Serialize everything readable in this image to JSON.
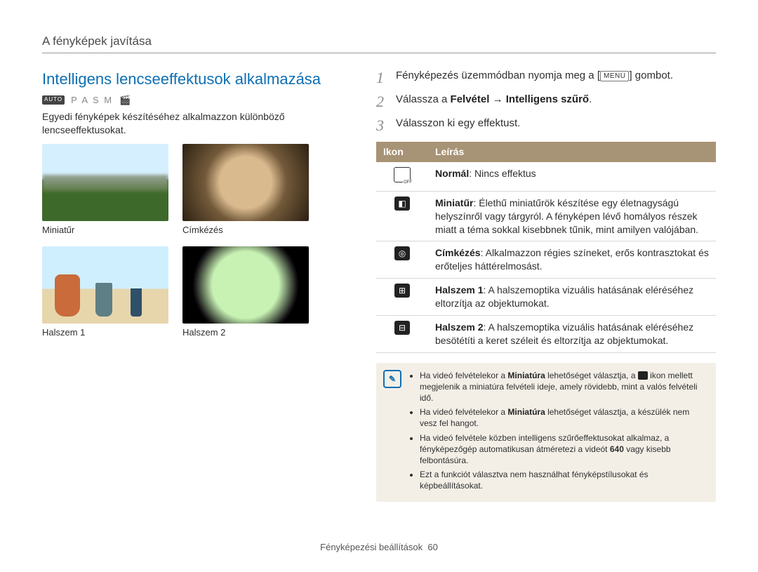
{
  "header": {
    "section": "A fényképek javítása"
  },
  "headline": "Intelligens lencseeffektusok alkalmazása",
  "modes": {
    "auto": "AUTO",
    "letters": "P A S M",
    "video": "🎬"
  },
  "intro": "Egyedi fényképek készítéséhez alkalmazzon különböző lencseeffektusokat.",
  "gallery": [
    {
      "caption": "Miniatűr"
    },
    {
      "caption": "Címkézés"
    },
    {
      "caption": "Halszem 1"
    },
    {
      "caption": "Halszem 2"
    }
  ],
  "steps": [
    {
      "n": "1",
      "pre": "Fényképezés üzemmódban nyomja meg a ",
      "button": "MENU",
      "post": " gombot."
    },
    {
      "n": "2",
      "pre": "Válassza a ",
      "bold": "Felvétel → Intelligens szűrő",
      "post": "."
    },
    {
      "n": "3",
      "pre": "Válasszon ki egy effektust."
    }
  ],
  "table": {
    "head_icon": "Ikon",
    "head_desc": "Leírás",
    "rows": [
      {
        "bold": "Normál",
        "rest": ": Nincs effektus"
      },
      {
        "bold": "Miniatűr",
        "rest": ": Élethű miniatűrök készítése egy életnagyságú helyszínről vagy tárgyról. A fényképen lévő homályos részek miatt a téma sokkal kisebbnek tűnik, mint amilyen valójában."
      },
      {
        "bold": "Címkézés",
        "rest": ": Alkalmazzon régies színeket, erős kontrasztokat és erőteljes háttérelmosást."
      },
      {
        "bold": "Halszem 1",
        "rest": ": A halszemoptika vizuális hatásának eléréséhez eltorzítja az objektumokat."
      },
      {
        "bold": "Halszem 2",
        "rest": ": A halszemoptika vizuális hatásának eléréséhez besötétíti a keret széleit és eltorzítja az objektumokat."
      }
    ]
  },
  "notes": [
    {
      "pre": "Ha videó felvételekor a ",
      "b1": "Miniatúra",
      "mid": " lehetőséget választja, a ",
      "icon": true,
      "post": " ikon mellett megjelenik a miniatúra felvételi ideje, amely rövidebb, mint a valós felvételi idő."
    },
    {
      "pre": "Ha videó felvételekor a ",
      "b1": "Miniatúra",
      "post": " lehetőséget választja, a készülék nem vesz fel hangot."
    },
    {
      "pre": "Ha videó felvétele közben intelligens szűrőeffektusokat alkalmaz, a fényképezőgép automatikusan átméretezi a videót ",
      "b640": "640",
      "post": " vagy kisebb felbontásúra."
    },
    {
      "pre": "Ezt a funkciót választva nem használhat fényképstílusokat és képbeállításokat."
    }
  ],
  "footer": {
    "label": "Fényképezési beállítások",
    "page": "60"
  }
}
